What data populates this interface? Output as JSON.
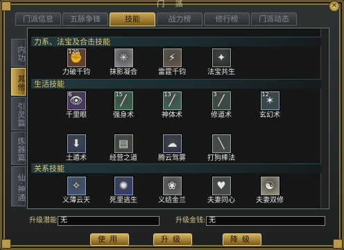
{
  "window": {
    "title": "门 派",
    "close": "✕"
  },
  "tabs": [
    "门派信息",
    "五脉争锋",
    "技能",
    "战力榜",
    "修行榜",
    "门派动态"
  ],
  "active_tab": 2,
  "side_tabs": [
    "内功",
    "其他",
    "引灵篇",
    "炼器篇",
    "仙·神通"
  ],
  "active_side_tab": 1,
  "sections": {
    "combo": "力系、法宝及合击技能",
    "life": "生活技能",
    "relation": "关系技能"
  },
  "skills_combo": [
    {
      "label": "力破千钧",
      "level": "120",
      "icon": "power-strike-icon",
      "color": "#6a3b22",
      "glyph": "✊"
    },
    {
      "label": "抹影凝合",
      "level": "",
      "icon": "burst-icon",
      "color": "#8d8f94",
      "glyph": "✳"
    },
    {
      "label": "雷霆千钧",
      "level": "",
      "icon": "thunder-icon",
      "color": "#6b5a48",
      "glyph": "⚡"
    },
    {
      "label": "法宝共生",
      "level": "",
      "icon": "treasure-icon",
      "color": "#2a2a2a",
      "glyph": "✦"
    }
  ],
  "skills_life": [
    {
      "label": "千里眼",
      "level": "6",
      "icon": "far-sight-icon",
      "color": "#4a2f6a",
      "glyph": "👁"
    },
    {
      "label": "强身术",
      "level": "15",
      "icon": "body-strength-icon",
      "color": "#2f6a4a",
      "glyph": "╱"
    },
    {
      "label": "神体术",
      "level": "13",
      "icon": "divine-body-icon",
      "color": "#3a6a58",
      "glyph": "╱"
    },
    {
      "label": "修道术",
      "level": "3",
      "icon": "dao-cultivation-icon",
      "color": "#2f4f3a",
      "glyph": "╱"
    },
    {
      "label": "玄幻术",
      "level": "12",
      "icon": "illusion-icon",
      "color": "#2a4a54",
      "glyph": "✶"
    },
    {
      "label": "土遁术",
      "level": "",
      "icon": "earth-escape-icon",
      "color": "#2c3a5a",
      "glyph": "⬇"
    },
    {
      "label": "经营之道",
      "level": "",
      "icon": "business-icon",
      "color": "#3e4a3a",
      "glyph": "▤"
    },
    {
      "label": "腾云驾雾",
      "level": "",
      "icon": "cloud-ride-icon",
      "color": "#2a2f4a",
      "glyph": "☁"
    },
    {
      "label": "打狗棒法",
      "level": "",
      "icon": "staff-technique-icon",
      "color": "#4a4a4a",
      "glyph": "╲"
    }
  ],
  "skills_relation": [
    {
      "label": "义薄云天",
      "level": "",
      "icon": "loyalty-icon",
      "color": "#3a5a8a",
      "glyph": "✧"
    },
    {
      "label": "死里逃生",
      "level": "",
      "icon": "escape-death-icon",
      "color": "#2a3a7a",
      "glyph": "✺"
    },
    {
      "label": "义结金兰",
      "level": "",
      "icon": "sworn-brothers-icon",
      "color": "#6a6a6a",
      "glyph": "❀"
    },
    {
      "label": "夫妻同心",
      "level": "",
      "icon": "couple-heart-icon",
      "color": "#4a4a4a",
      "glyph": "♥"
    },
    {
      "label": "夫妻双修",
      "level": "",
      "icon": "couple-cultivation-icon",
      "color": "#a89a7a",
      "glyph": "☯"
    }
  ],
  "bottom": {
    "potential_label": "升级潜能:",
    "potential_value": "无",
    "money_label": "升级金钱:",
    "money_value": "无"
  },
  "buttons": {
    "use": "使用",
    "upgrade": "升级",
    "downgrade": "降级"
  }
}
